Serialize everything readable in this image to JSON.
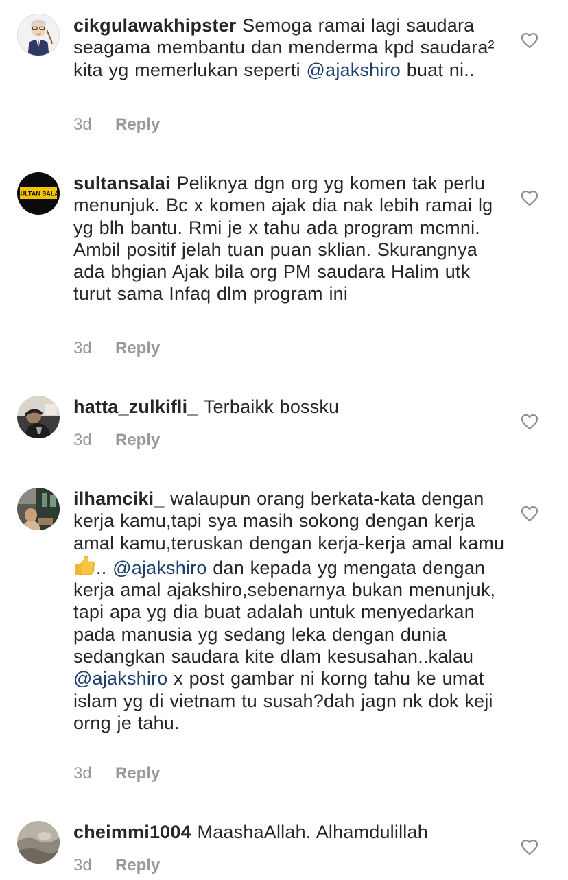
{
  "comments": [
    {
      "username": "cikgulawakhipster",
      "text_parts": [
        {
          "t": "Semoga ramai lagi saudara seagama membantu dan menderma kpd saudara² kita yg memerlukan seperti "
        },
        {
          "m": "@ajakshiro"
        },
        {
          "t": " buat ni.."
        }
      ],
      "time": "3d",
      "reply_label": "Reply",
      "avatar_icon": "cartoon-teacher-avatar"
    },
    {
      "username": "sultansalai",
      "text_parts": [
        {
          "t": "Peliknya dgn org yg komen tak perlu menunjuk. Bc x komen ajak dia nak lebih ramai lg yg blh bantu. Rmi je x tahu ada program mcmni. Ambil positif jelah tuan puan sklian. Skurangnya ada bhgian Ajak bila org PM saudara Halim utk turut sama Infaq dlm program ini"
        }
      ],
      "time": "3d",
      "reply_label": "Reply",
      "avatar_icon": "sultan-salai-logo-avatar",
      "avatar_text": "SULTAN SALAI"
    },
    {
      "username": "hatta_zulkifli_",
      "text_parts": [
        {
          "t": "Terbaikk bossku"
        }
      ],
      "time": "3d",
      "reply_label": "Reply",
      "avatar_icon": "photo-avatar"
    },
    {
      "username": "ilhamciki_",
      "text_parts": [
        {
          "t": "walaupun orang berkata-kata dengan kerja kamu,tapi sya masih sokong dengan kerja amal kamu,teruskan dengan kerja-kerja amal kamu"
        },
        {
          "e": "thumbs-up-emoji"
        },
        {
          "t": ".. "
        },
        {
          "m": "@ajakshiro"
        },
        {
          "t": " dan kepada yg mengata dengan kerja amal ajakshiro,sebenarnya bukan menunjuk, tapi apa yg dia buat adalah untuk menyedarkan pada manusia yg sedang leka dengan dunia sedangkan saudara kite dlam kesusahan..kalau "
        },
        {
          "m": "@ajakshiro"
        },
        {
          "t": " x post gambar ni korng tahu ke umat islam yg di vietnam tu susah?dah jagn nk dok keji orng je tahu."
        }
      ],
      "time": "3d",
      "reply_label": "Reply",
      "avatar_icon": "photo-avatar"
    },
    {
      "username": "cheimmi1004",
      "text_parts": [
        {
          "t": "MaashaAllah. Alhamdulillah"
        }
      ],
      "time": "3d",
      "reply_label": "Reply",
      "avatar_icon": "photo-avatar"
    }
  ],
  "colors": {
    "text": "#262626",
    "muted": "#999999",
    "mention": "#1c3f6e",
    "heart_outline": "#8e8e8e"
  },
  "like_icon": "heart-outline-icon"
}
